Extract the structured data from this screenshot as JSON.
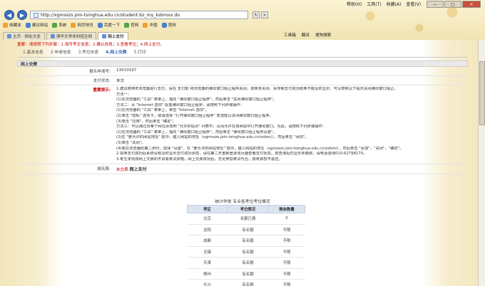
{
  "browser": {
    "url": "http://xgmsszs.join-tsinghua.edu.cn/student.bz_my_ksbmxx.do",
    "menu": [
      "帮助(H)",
      "工具(T)",
      "收藏(A)",
      "查看(V)"
    ],
    "window_buttons": [
      "—",
      "□",
      "×"
    ],
    "favorites": [
      {
        "label": "收藏夹"
      },
      {
        "label": "建议网站"
      },
      {
        "label": "系统"
      },
      {
        "label": "网页快讯"
      },
      {
        "label": "百度一下"
      },
      {
        "label": "官网"
      },
      {
        "label": "中国"
      },
      {
        "label": "官网"
      }
    ],
    "tabs": [
      {
        "label": "主页 · 网址大全"
      },
      {
        "label": "清华大学本科招生网"
      },
      {
        "label": "网上支付"
      }
    ],
    "tools": [
      "工具箱",
      "翻译",
      "搜狗搜索"
    ]
  },
  "page": {
    "notice": "重要：请按照下列步骤：1.填写考生信息；2.确认信息；3.查看考位；4.网上支付。",
    "steps": [
      {
        "label": "1.基本信息",
        "active": false
      },
      {
        "label": "2.申请信息",
        "active": false
      },
      {
        "label": "3.考位信息",
        "active": false
      },
      {
        "label": "4.网上交费",
        "active": true
      },
      {
        "label": "5.打印",
        "active": false
      }
    ],
    "section_title": "网上交费",
    "fields": {
      "app_no_label": "报名申请号:",
      "app_no_value": "13010167",
      "pay_status_label": "支付状态:",
      "pay_status_value": "未交",
      "important_label": "重要提示:",
      "pay_label": "报名费:",
      "pay_amount": "未交费",
      "pay_button": "网上支付"
    },
    "instructions": [
      "1.建议使用IE浏览器进行支付，请在 支付前 将浏览器的弹出窗口阻止程序关闭，如果未关闭，会导致支付成功结果不能及时显示。可以按照以下提示关闭弹出窗口阻止。",
      "方法一：",
      "(1)在浏览器的 \"工具\" 菜单上，指向 \"弹出窗口阻止程序\"，然后单击 \"关闭弹出窗口阻止程序\"。",
      "方法二：从 \"Internet 选项\" 配置弹出窗口阻止程序，请按照下列步骤操作：",
      "(1)在浏览器的 \"工具\" 菜单上，单击 \"Internet 选项\"。",
      "(2)单击 \"隐私\" 选项卡，取消选择 \"打开弹出窗口阻止程序\" 复选框以关闭弹出窗口阻止程序。",
      "(3)单击 \"应用\"，然后单击 \"确定\"。",
      "方法三：可以通过对某个网址添加到 \"允许的站点\" 列表中，从而允许在该网站中打开弹出窗口。为此，请按照下列步骤操作：",
      "(1)在浏览器的 \"工具\" 菜单上，指向 \"弹出窗口阻止程序\"，然后单击 \"弹出窗口阻止程序设置\"。",
      "(2)在 \"要允许的网站地址\" 框中，键入网站的地址（xgmsszs.join-tsinghua.edu.cn/xsbm/），然后单击 \"添加\"。",
      "(3)单击 \"关闭\"。",
      "(4)或在浏览器的第二步时，选择 \"设置\"，在 \"要允许的网站地址\" 框中，键入网站的地址（xgmsszs.join-tsinghua.edu.cn/xsbm/），然后单击 \"添加\"，\"关闭\"，\"确定\"。",
      "2.如果支付成功后系统没有及时显示支付成功状态，请在第二天重新登录该页面查看支付状态，若查询后仍显示未缴费，请电话咨询010-62798170。",
      "3.考生未完成网上交费的不具有考试资格，网上交费成功后，无论参加考试与否，报考费恕不退还。"
    ],
    "quota": {
      "title": "统计学类  专业各考位考位情况",
      "headers": [
        "考区",
        "考位情况",
        "剩余数量"
      ],
      "rows": [
        [
          "北京",
          "名额已满",
          "0"
        ],
        [
          "沈阳",
          "有名额",
          "不限"
        ],
        [
          "成都",
          "有名额",
          "不限"
        ],
        [
          "无锡",
          "有名额",
          "不限"
        ],
        [
          "天津",
          "有名额",
          "不限"
        ],
        [
          "柳州",
          "有名额",
          "不限"
        ],
        [
          "长沙",
          "有名额",
          "不限"
        ]
      ]
    }
  }
}
